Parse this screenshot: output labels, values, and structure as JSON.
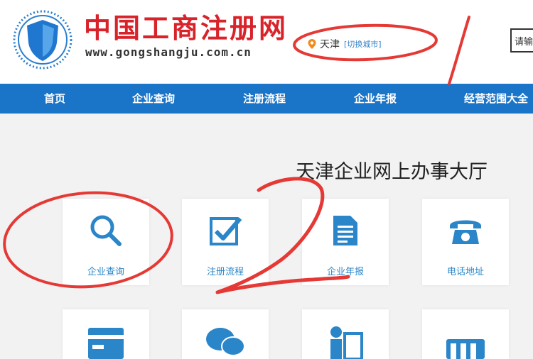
{
  "header": {
    "logo_title": "中国工商注册网",
    "logo_url": "www.gongshangju.com.cn",
    "city": "天津",
    "city_switch": "[切换城市]",
    "search_placeholder": "请输"
  },
  "nav": {
    "items": [
      "首页",
      "企业查询",
      "注册流程",
      "企业年报",
      "经营范围大全"
    ]
  },
  "main": {
    "title": "天津企业网上办事大厅",
    "cards": [
      {
        "label": "企业查询",
        "icon": "magnifier-icon"
      },
      {
        "label": "注册流程",
        "icon": "checkbox-icon"
      },
      {
        "label": "企业年报",
        "icon": "document-icon"
      },
      {
        "label": "电话地址",
        "icon": "telephone-icon"
      }
    ],
    "cards_row2": [
      {
        "icon": "card-icon"
      },
      {
        "icon": "chat-bubbles-icon"
      },
      {
        "icon": "person-doc-icon"
      },
      {
        "icon": "bars-icon"
      }
    ]
  },
  "annotations": {
    "marks": [
      "1",
      "2"
    ],
    "color": "#e53935"
  },
  "colors": {
    "brand_red": "#d8232a",
    "nav_blue": "#1a74c8",
    "icon_blue": "#2a86c8"
  }
}
